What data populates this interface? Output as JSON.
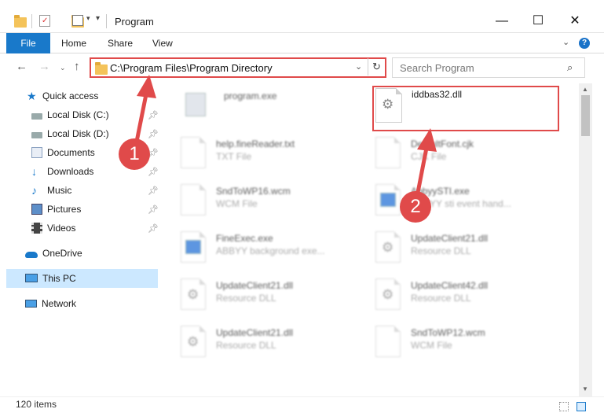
{
  "window": {
    "title": "Program",
    "minimize_glyph": "—",
    "maximize_glyph": "☐",
    "close_glyph": "✕"
  },
  "ribbon": {
    "file": "File",
    "home": "Home",
    "share": "Share",
    "view": "View",
    "help": "?"
  },
  "nav": {
    "address": "C:\\Program Files\\Program Directory",
    "search_placeholder": "Search Program"
  },
  "sidebar": {
    "items": [
      {
        "label": "Quick access",
        "icon": "star-icon",
        "pinned": false
      },
      {
        "label": "Local Disk (C:)",
        "icon": "drive-icon",
        "pinned": true
      },
      {
        "label": "Local Disk (D:)",
        "icon": "drive-icon",
        "pinned": true
      },
      {
        "label": "Documents",
        "icon": "documents-icon",
        "pinned": true
      },
      {
        "label": "Downloads",
        "icon": "download-arrow-icon",
        "pinned": true
      },
      {
        "label": "Music",
        "icon": "music-note-icon",
        "pinned": true
      },
      {
        "label": "Pictures",
        "icon": "pictures-icon",
        "pinned": true
      },
      {
        "label": "Videos",
        "icon": "film-icon",
        "pinned": true
      },
      {
        "label": "OneDrive",
        "icon": "cloud-icon",
        "pinned": false
      },
      {
        "label": "This PC",
        "icon": "monitor-icon",
        "pinned": false,
        "selected": true
      },
      {
        "label": "Network",
        "icon": "network-icon",
        "pinned": false
      }
    ]
  },
  "files": [
    {
      "name": "program.exe",
      "desc": "",
      "icon": "exe-icon",
      "blurred": true
    },
    {
      "name": "iddbas32.dll",
      "desc": "",
      "icon": "dll-gear-icon",
      "blurred": false,
      "highlighted": true
    },
    {
      "name": "help.fineReader.txt",
      "desc": "TXT File",
      "icon": "text-file-icon",
      "blurred": true
    },
    {
      "name": "DefaultFont.cjk",
      "desc": "CJK File",
      "icon": "file-icon",
      "blurred": true
    },
    {
      "name": "SndToWP16.wcm",
      "desc": "WCM File",
      "icon": "file-icon",
      "blurred": true
    },
    {
      "name": "AbbyySTI.exe",
      "desc": "ABBYY sti event hand...",
      "icon": "exe-icon",
      "blurred": true
    },
    {
      "name": "FineExec.exe",
      "desc": "ABBYY background exe...",
      "icon": "exe-icon",
      "blurred": true
    },
    {
      "name": "UpdateClient21.dll",
      "desc": "Resource DLL",
      "icon": "dll-gear-icon",
      "blurred": true
    },
    {
      "name": "UpdateClient21.dll",
      "desc": "Resource DLL",
      "icon": "dll-gear-icon",
      "blurred": true
    },
    {
      "name": "UpdateClient42.dll",
      "desc": "Resource DLL",
      "icon": "dll-gear-icon",
      "blurred": true
    },
    {
      "name": "UpdateClient21.dll",
      "desc": "Resource DLL",
      "icon": "dll-gear-icon",
      "blurred": true
    },
    {
      "name": "SndToWP12.wcm",
      "desc": "WCM File",
      "icon": "file-icon",
      "blurred": true
    }
  ],
  "annotations": {
    "step1": "1",
    "step2": "2",
    "color": "#e04a4a"
  },
  "status": {
    "item_count": "120 items"
  }
}
